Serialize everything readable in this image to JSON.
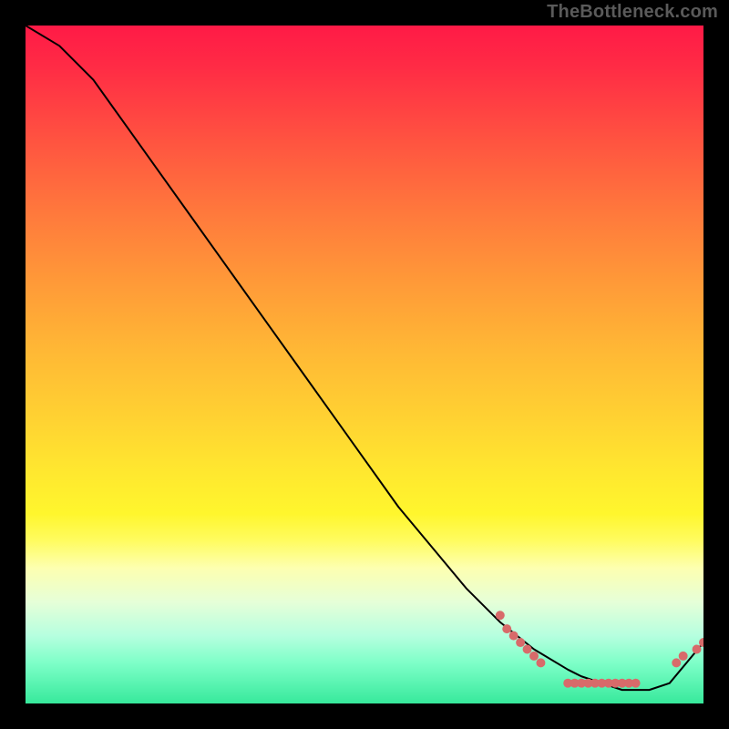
{
  "watermark": "TheBottleneck.com",
  "chart_data": {
    "type": "line",
    "title": "",
    "xlabel": "",
    "ylabel": "",
    "xlim": [
      0,
      100
    ],
    "ylim": [
      0,
      100
    ],
    "grid": false,
    "legend": false,
    "series": [
      {
        "name": "curve",
        "color": "#000000",
        "x": [
          0,
          5,
          10,
          15,
          20,
          25,
          30,
          35,
          40,
          45,
          50,
          55,
          60,
          65,
          70,
          75,
          80,
          82,
          85,
          88,
          90,
          92,
          95,
          100
        ],
        "y": [
          100,
          97,
          92,
          85,
          78,
          71,
          64,
          57,
          50,
          43,
          36,
          29,
          23,
          17,
          12,
          8,
          5,
          4,
          3,
          2,
          2,
          2,
          3,
          9
        ]
      }
    ],
    "markers": [
      {
        "name": "dots",
        "color": "#d86a6a",
        "radius_px": 5,
        "points": [
          {
            "x": 70,
            "y": 13
          },
          {
            "x": 71,
            "y": 11
          },
          {
            "x": 72,
            "y": 10
          },
          {
            "x": 73,
            "y": 9
          },
          {
            "x": 74,
            "y": 8
          },
          {
            "x": 75,
            "y": 7
          },
          {
            "x": 76,
            "y": 6
          },
          {
            "x": 80,
            "y": 3
          },
          {
            "x": 81,
            "y": 3
          },
          {
            "x": 82,
            "y": 3
          },
          {
            "x": 83,
            "y": 3
          },
          {
            "x": 84,
            "y": 3
          },
          {
            "x": 85,
            "y": 3
          },
          {
            "x": 86,
            "y": 3
          },
          {
            "x": 87,
            "y": 3
          },
          {
            "x": 88,
            "y": 3
          },
          {
            "x": 89,
            "y": 3
          },
          {
            "x": 90,
            "y": 3
          },
          {
            "x": 96,
            "y": 6
          },
          {
            "x": 97,
            "y": 7
          },
          {
            "x": 99,
            "y": 8
          },
          {
            "x": 100,
            "y": 9
          }
        ]
      }
    ]
  }
}
